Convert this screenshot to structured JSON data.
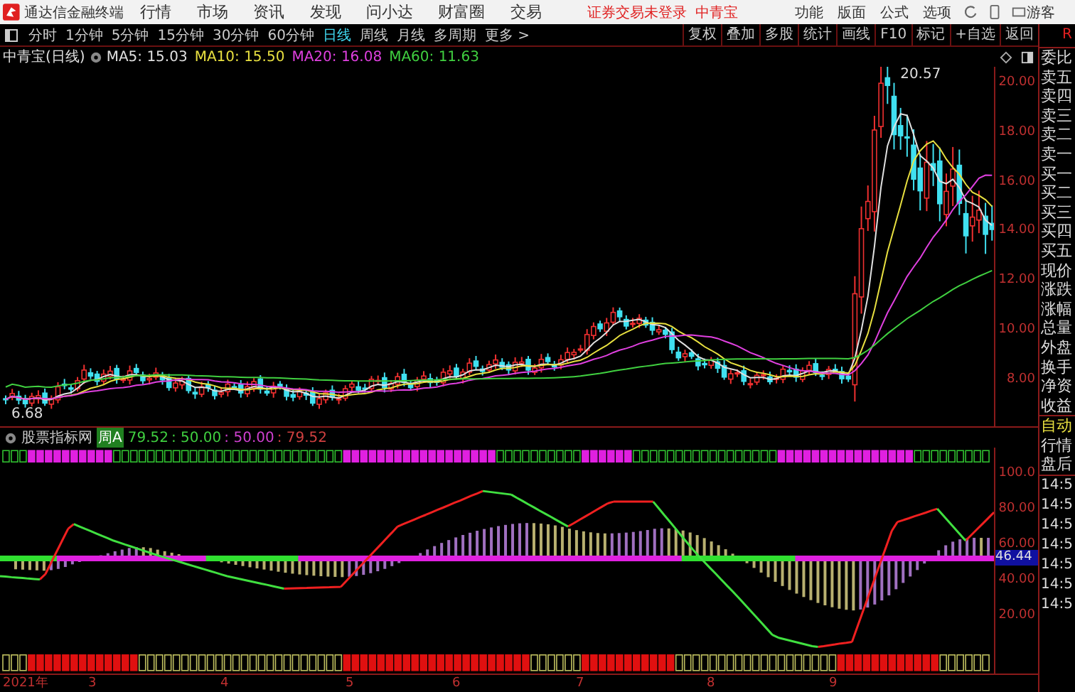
{
  "title_bar": {
    "app_name": "通达信金融终端",
    "menus": [
      "行情",
      "市场",
      "资讯",
      "发现",
      "问小达",
      "财富圈",
      "交易"
    ],
    "login_status": "证券交易未登录",
    "stock_name": "中青宝",
    "tools": [
      "功能",
      "版面",
      "公式",
      "选项"
    ],
    "user": "游客"
  },
  "toolbar": {
    "periods": [
      {
        "label": "分时",
        "selected": false
      },
      {
        "label": "1分钟",
        "selected": false
      },
      {
        "label": "5分钟",
        "selected": false
      },
      {
        "label": "15分钟",
        "selected": false
      },
      {
        "label": "30分钟",
        "selected": false
      },
      {
        "label": "60分钟",
        "selected": false
      },
      {
        "label": "日线",
        "selected": true
      },
      {
        "label": "周线",
        "selected": false
      },
      {
        "label": "月线",
        "selected": false
      },
      {
        "label": "多周期",
        "selected": false
      },
      {
        "label": "更多 >",
        "selected": false
      }
    ],
    "actions": [
      "复权",
      "叠加",
      "多股",
      "统计",
      "画线",
      "F10",
      "标记",
      "+自选",
      "返回"
    ]
  },
  "chart_header": {
    "title": "中青宝(日线)",
    "ma_legend": [
      {
        "label": "MA5: 15.03",
        "color": "#e0e0e0"
      },
      {
        "label": "MA10: 15.50",
        "color": "#e8e040"
      },
      {
        "label": "MA20: 16.08",
        "color": "#e040e0"
      },
      {
        "label": "MA60: 11.63",
        "color": "#40d040"
      }
    ]
  },
  "price_axis": [
    "20.00",
    "18.00",
    "16.00",
    "14.00",
    "12.00",
    "10.00",
    "8.00"
  ],
  "price_annotations": {
    "high": "20.57",
    "low": "6.68"
  },
  "indicator": {
    "name": "股票指标网",
    "tag": "周A",
    "values": [
      {
        "label": "79.52",
        "color": "#40d040"
      },
      {
        "label": ": 50.00",
        "color": "#40d040"
      },
      {
        "label": ": 50.00",
        "color": "#d040d0"
      },
      {
        "label": ": 79.52",
        "color": "#d04040"
      }
    ],
    "axis": [
      "100.0",
      "80.00",
      "60.00",
      "40.00",
      "20.00"
    ],
    "current_value": "46.44"
  },
  "date_axis": [
    "2021年",
    "3",
    "4",
    "5",
    "6",
    "7",
    "8",
    "9"
  ],
  "side_panel": {
    "header": "R",
    "quote_labels": [
      "委比",
      "卖五",
      "卖四",
      "卖三",
      "卖二",
      "卖一",
      "买一",
      "买二",
      "买三",
      "买四",
      "买五",
      "现价",
      "涨跌",
      "涨幅",
      "总量",
      "外盘",
      "换手",
      "净资",
      "收益"
    ],
    "modes": [
      {
        "label": "自动",
        "selected": true
      },
      {
        "label": "行情",
        "selected": false
      },
      {
        "label": "盘后",
        "selected": false
      }
    ],
    "trade_times": [
      "14:5",
      "14:5",
      "14:5",
      "14:5",
      "14:5",
      "14:5",
      "14:5"
    ]
  }
}
